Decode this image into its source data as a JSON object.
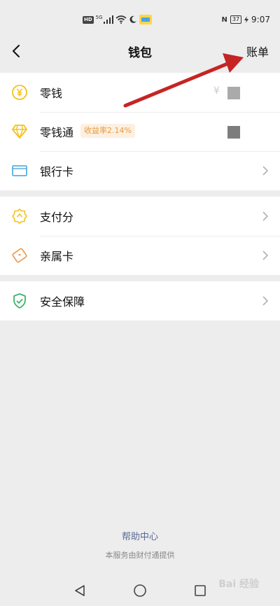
{
  "status_bar": {
    "hd": "HD",
    "network": "5G",
    "battery": "37",
    "time": "9:07",
    "nfc": "N"
  },
  "header": {
    "title": "钱包",
    "bill_label": "账单"
  },
  "section1": {
    "items": [
      {
        "label": "零钱",
        "icon": "coin-icon",
        "currency": "¥"
      },
      {
        "label": "零钱通",
        "icon": "diamond-icon",
        "badge": "收益率2.14%"
      },
      {
        "label": "银行卡",
        "icon": "bank-card-icon"
      }
    ]
  },
  "section2": {
    "items": [
      {
        "label": "支付分",
        "icon": "pay-score-icon"
      },
      {
        "label": "亲属卡",
        "icon": "family-card-icon"
      }
    ]
  },
  "section3": {
    "items": [
      {
        "label": "安全保障",
        "icon": "shield-icon"
      }
    ]
  },
  "footer": {
    "help": "帮助中心",
    "provider": "本服务由财付通提供"
  },
  "watermark": "Bai 经验",
  "colors": {
    "background": "#ededed",
    "accent_yellow": "#f3c21a",
    "bank_blue": "#5aaee0",
    "shield_green": "#3fb36b",
    "family_orange": "#e8a25a",
    "badge_text": "#e59a44",
    "help_link": "#576b95",
    "arrow_red": "#c42524"
  }
}
